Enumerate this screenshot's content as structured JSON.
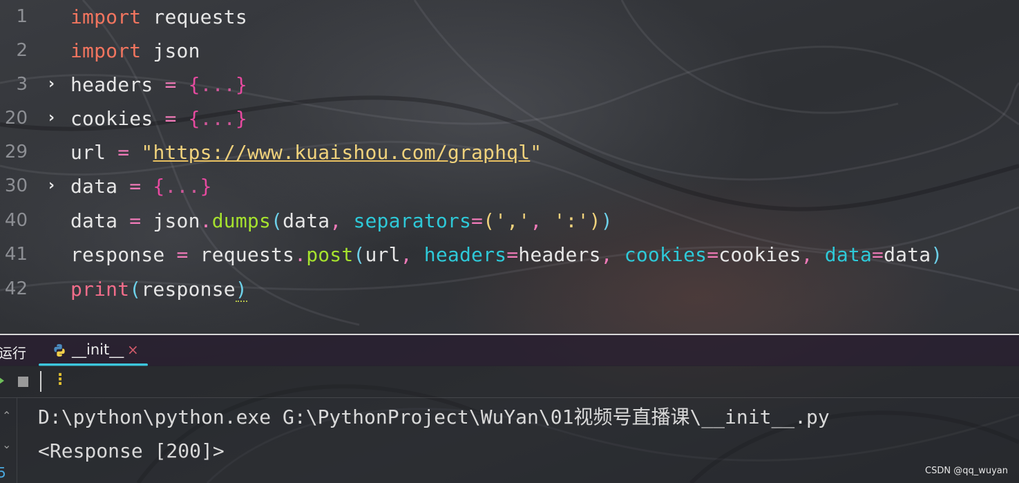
{
  "editor": {
    "line_numbers": [
      "1",
      "2",
      "3",
      "20",
      "29",
      "30",
      "40",
      "41",
      "42"
    ],
    "fold_glyph": "›"
  },
  "code": {
    "l1": {
      "kw": "import",
      "rest": " requests"
    },
    "l2": {
      "kw": "import",
      "rest": " json"
    },
    "l3": {
      "name": "headers",
      "eq": " = ",
      "open": "{",
      "dots": "...",
      "close": "}"
    },
    "l20": {
      "name": "cookies",
      "eq": " = ",
      "open": "{",
      "dots": "...",
      "close": "}"
    },
    "l29": {
      "name": "url",
      "eq": " = ",
      "q1": "\"",
      "url": "https://www.kuaishou.com/graphql",
      "q2": "\""
    },
    "l30": {
      "name": "data",
      "eq": " = ",
      "open": "{",
      "dots": "...",
      "close": "}"
    },
    "l40": {
      "a": "data",
      "eq": " = ",
      "mod": "json",
      "dot": ".",
      "fn": "dumps",
      "p1": "(",
      "arg": "data",
      "comma": ", ",
      "kw": "separators",
      "eq2": "=",
      "p2": "(",
      "s1": "','",
      "comma2": ", ",
      "s2": "':'",
      "p3": ")",
      "p4": ")"
    },
    "l41": {
      "a": "response",
      "eq": " = ",
      "mod": "requests",
      "dot": ".",
      "fn": "post",
      "p1": "(",
      "arg": "url",
      "c1": ", ",
      "k1": "headers",
      "e1": "=",
      "v1": "headers",
      "c2": ", ",
      "k2": "cookies",
      "e2": "=",
      "v2": "cookies",
      "c3": ", ",
      "k3": "data",
      "e3": "=",
      "v3": "data",
      "p2": ")"
    },
    "l42": {
      "fn": "print",
      "p1": "(",
      "arg": "response",
      "p2": ")"
    }
  },
  "run_panel": {
    "tool_window_label": "运行",
    "tab_label": "__init__",
    "tab_close": "×",
    "toolbar": {
      "more_glyph": "⋮"
    },
    "side": {
      "up": "⌃",
      "down": "⌄",
      "num": "5"
    },
    "console_lines": [
      "D:\\python\\python.exe G:\\PythonProject\\WuYan\\01视频号直播课\\__init__.py",
      "<Response [200]>"
    ]
  },
  "watermark": "CSDN @qq_wuyan",
  "colors": {
    "keyword": "#f2755f",
    "brace": "#e74aa0",
    "string": "#f0d27c",
    "function": "#a6e22e",
    "kwarg": "#2ec9d8",
    "tab_underline": "#3cc6dc"
  }
}
